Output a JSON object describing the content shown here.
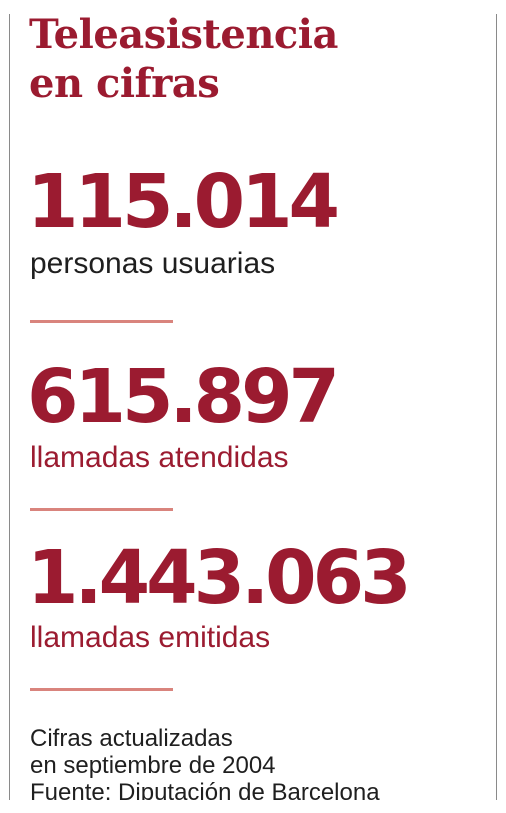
{
  "title": {
    "line1": "Teleasistencia",
    "line2": "en cifras"
  },
  "stats": [
    {
      "value": "115.014",
      "label": "personas usuarias"
    },
    {
      "value": "615.897",
      "label": "llamadas atendidas"
    },
    {
      "value": "1.443.063",
      "label": "llamadas emitidas"
    }
  ],
  "footer": {
    "line1": "Cifras actualizadas",
    "line2": "en septiembre de 2004",
    "line3": "Fuente: Diputación de Barcelona"
  },
  "colors": {
    "accent": "#9b1b30",
    "divider": "#d9847d",
    "text": "#1f1f1f",
    "border": "#8a8a8a"
  }
}
